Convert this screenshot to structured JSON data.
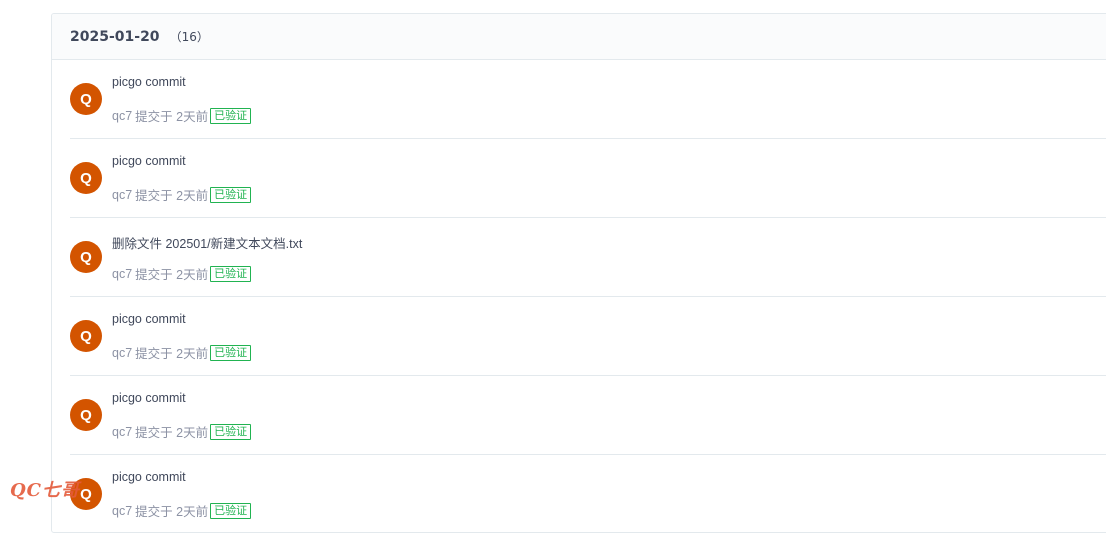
{
  "group": {
    "date": "2025-01-20",
    "count": "（16）"
  },
  "commits": [
    {
      "avatar": "Q",
      "message": "picgo commit",
      "author": "qc7",
      "submitted": "提交于 2天前",
      "badge": "已验证"
    },
    {
      "avatar": "Q",
      "message": "picgo commit",
      "author": "qc7",
      "submitted": "提交于 2天前",
      "badge": "已验证"
    },
    {
      "avatar": "Q",
      "message": "删除文件 202501/新建文本文档.txt",
      "author": "qc7",
      "submitted": "提交于 2天前",
      "badge": "已验证"
    },
    {
      "avatar": "Q",
      "message": "picgo commit",
      "author": "qc7",
      "submitted": "提交于 2天前",
      "badge": "已验证"
    },
    {
      "avatar": "Q",
      "message": "picgo commit",
      "author": "qc7",
      "submitted": "提交于 2天前",
      "badge": "已验证"
    },
    {
      "avatar": "Q",
      "message": "picgo commit",
      "author": "qc7",
      "submitted": "提交于 2天前",
      "badge": "已验证"
    }
  ],
  "watermark": "QC七哥",
  "colors": {
    "avatar_bg": "#d35400",
    "verified": "#21b351",
    "border": "#e3e9ed"
  }
}
